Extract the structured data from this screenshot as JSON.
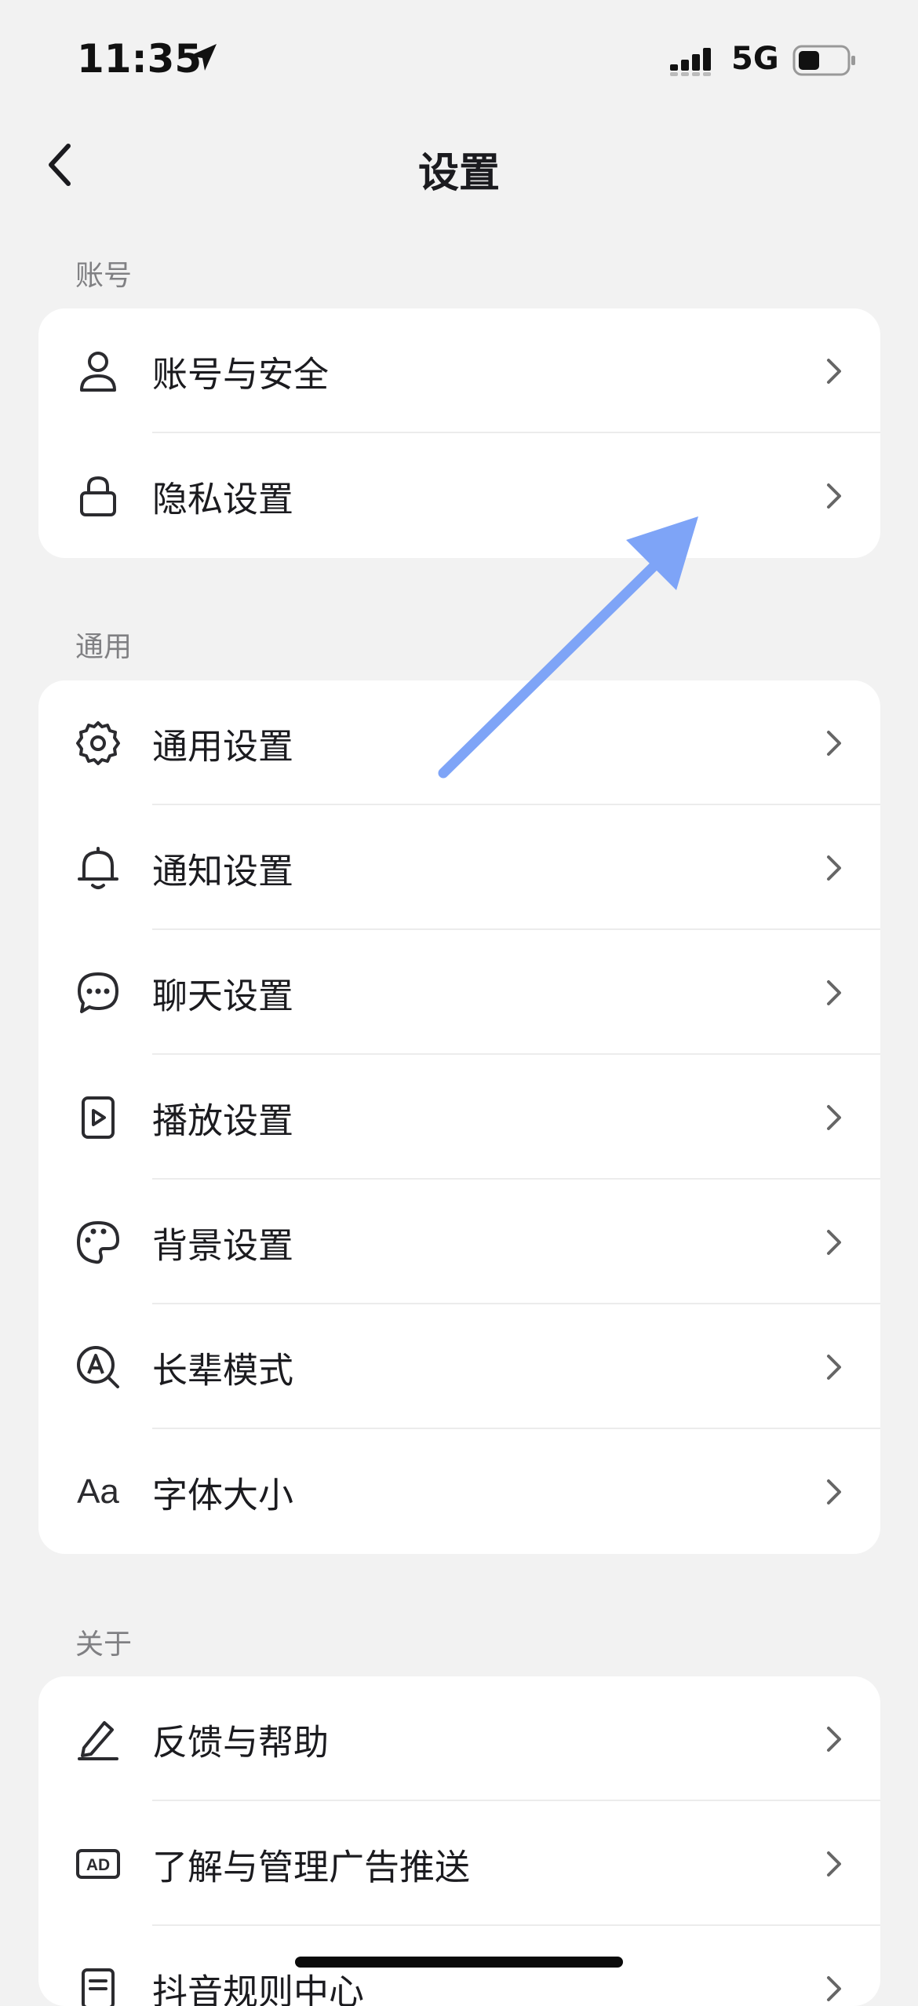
{
  "status_bar": {
    "time": "11:35",
    "network": "5G"
  },
  "nav": {
    "title": "设置",
    "back_icon": "chevron-left-icon"
  },
  "sections": [
    {
      "header": "账号",
      "items": [
        {
          "icon": "user-icon",
          "label": "账号与安全"
        },
        {
          "icon": "lock-icon",
          "label": "隐私设置"
        }
      ]
    },
    {
      "header": "通用",
      "items": [
        {
          "icon": "gear-icon",
          "label": "通用设置"
        },
        {
          "icon": "bell-icon",
          "label": "通知设置"
        },
        {
          "icon": "chat-bubble-icon",
          "label": "聊天设置"
        },
        {
          "icon": "play-icon",
          "label": "播放设置"
        },
        {
          "icon": "palette-icon",
          "label": "背景设置"
        },
        {
          "icon": "elder-mode-icon",
          "label": "长辈模式"
        },
        {
          "icon": "font-size-icon",
          "label": "字体大小",
          "icon_text": "Aa"
        }
      ]
    },
    {
      "header": "关于",
      "items": [
        {
          "icon": "pen-icon",
          "label": "反馈与帮助"
        },
        {
          "icon": "ad-icon",
          "label": "了解与管理广告推送",
          "icon_text": "AD"
        },
        {
          "icon": "document-icon",
          "label": "抖音规则中心"
        }
      ]
    }
  ],
  "colors": {
    "background": "#f2f2f2",
    "card": "#ffffff",
    "section_header": "#808083",
    "annotation_arrow": "#7ea4f7"
  }
}
